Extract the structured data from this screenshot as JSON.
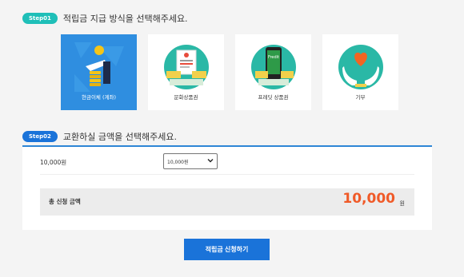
{
  "step1": {
    "badge": "Step01",
    "title": "적립금 지급 방식을 선택해주세요.",
    "color": "#1fbfb8"
  },
  "options": [
    {
      "label": "현금이체 (계좌)",
      "icon": "cash-transfer-icon",
      "selected": true
    },
    {
      "label": "문화상품권",
      "icon": "culture-voucher-icon",
      "selected": false
    },
    {
      "label": "프레딧 상품권",
      "icon": "fredit-voucher-icon",
      "selected": false
    },
    {
      "label": "기부",
      "icon": "donation-icon",
      "selected": false
    }
  ],
  "step2": {
    "badge": "Step02",
    "title": "교환하실 금액을 선택해주세요.",
    "color": "#1a73d9"
  },
  "amount": {
    "label": "10,000원",
    "select_value": "10,000원"
  },
  "total": {
    "label": "총 신청 금액",
    "value": "10,000",
    "unit": "원"
  },
  "submit": {
    "label": "적립금 신청하기"
  },
  "colors": {
    "selected_card": "#2f8ee0",
    "accent": "#f05a28",
    "button": "#1a73d9"
  }
}
